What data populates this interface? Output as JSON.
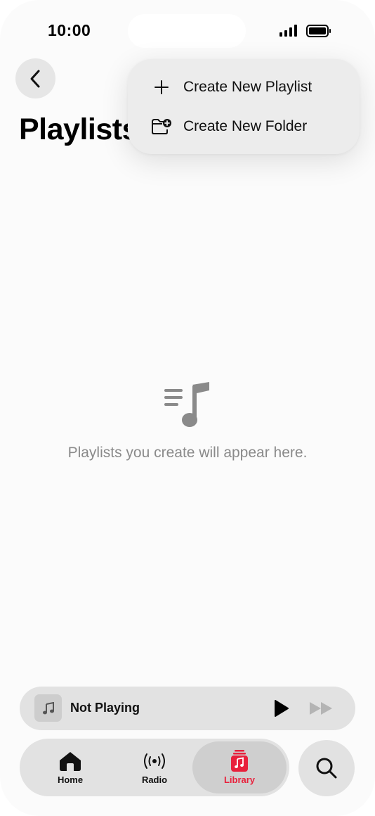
{
  "status_bar": {
    "time": "10:00"
  },
  "header": {
    "title": "Playlists"
  },
  "menu": {
    "items": [
      {
        "label": "Create New Playlist",
        "icon": "plus-icon"
      },
      {
        "label": "Create New Folder",
        "icon": "folder-add-icon"
      }
    ]
  },
  "empty_state": {
    "icon": "playlist-music-icon",
    "message": "Playlists you create will appear here."
  },
  "mini_player": {
    "title": "Not Playing"
  },
  "tab_bar": {
    "tabs": [
      {
        "label": "Home",
        "icon": "home-icon"
      },
      {
        "label": "Radio",
        "icon": "radio-icon"
      },
      {
        "label": "Library",
        "icon": "library-icon",
        "selected": true
      }
    ]
  },
  "colors": {
    "accent": "#e8203b",
    "text_secondary": "#8a8a8a"
  }
}
